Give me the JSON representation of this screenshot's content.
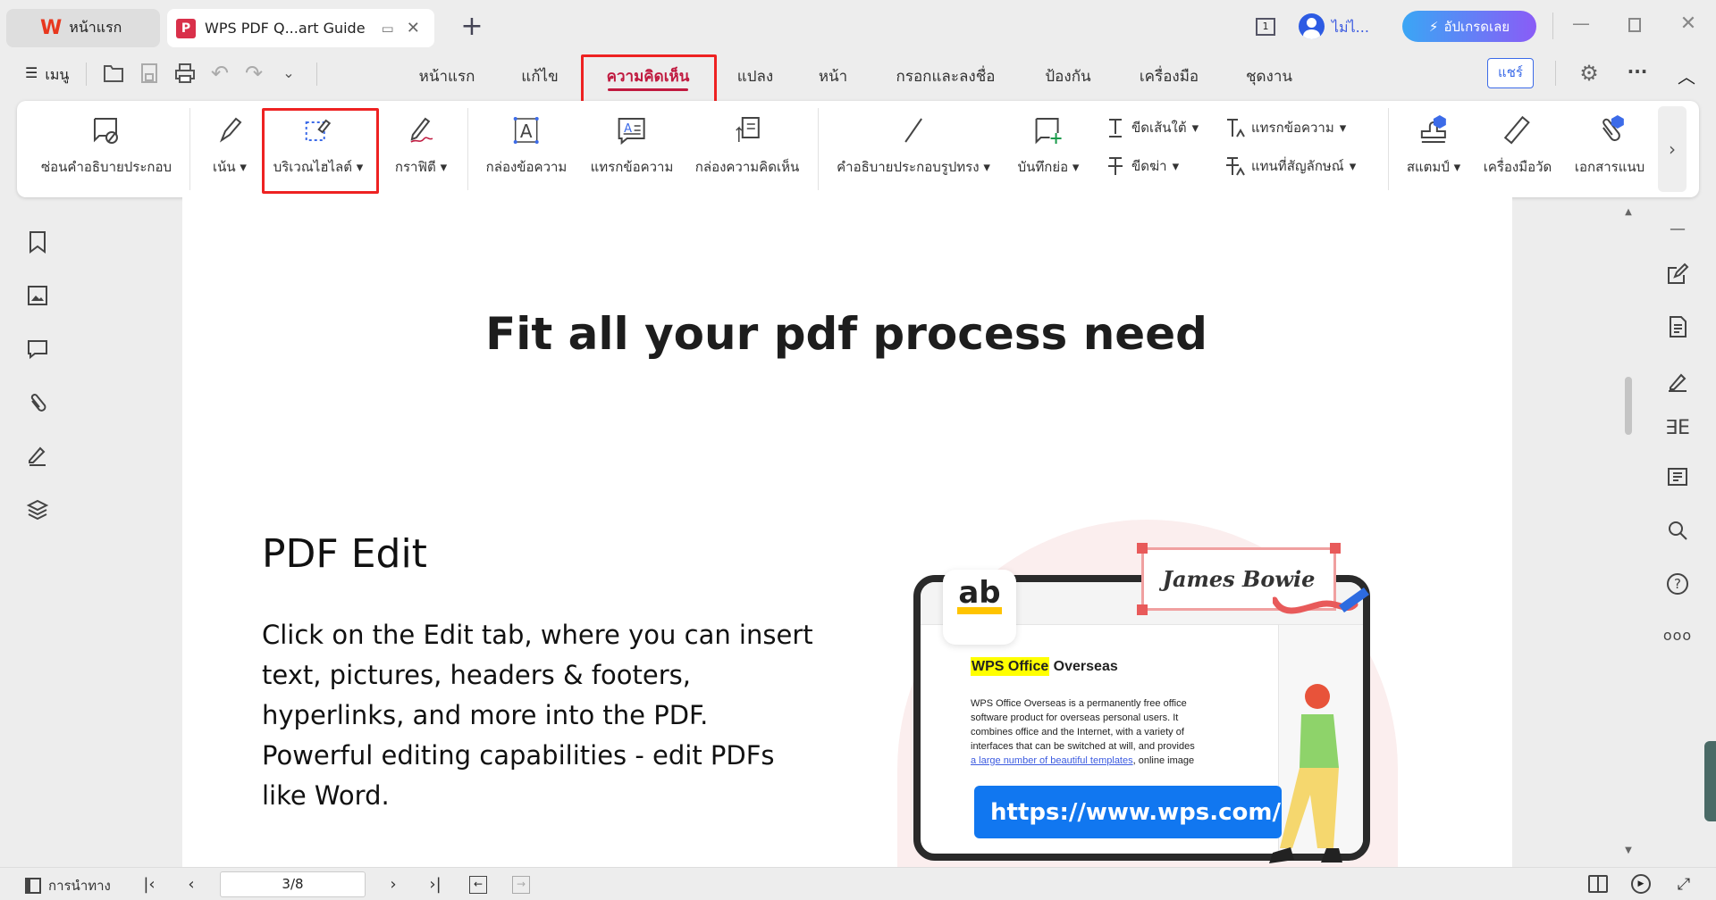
{
  "titlebar": {
    "home_tab": "หน้าแรก",
    "doc_tab": "WPS PDF Q...art Guide",
    "new_tab": "+",
    "page_count_badge": "1",
    "user_name": "ไม่ไ...",
    "upgrade_label": "อัปเกรดเลย"
  },
  "menubar": {
    "menu_label": "เมนู",
    "tabs": [
      "หน้าแรก",
      "แก้ไข",
      "ความคิดเห็น",
      "แปลง",
      "หน้า",
      "กรอกและลงชื่อ",
      "ป้องกัน",
      "เครื่องมือ",
      "ชุดงาน"
    ],
    "active_tab": "ความคิดเห็น",
    "share_label": "แชร์"
  },
  "ribbon": {
    "hide_annotations": "ซ่อนคำอธิบายประกอบ",
    "highlight": "เน้น",
    "area_highlight": "บริเวณไฮไลต์",
    "graffiti": "กราฟิตี",
    "text_box": "กล่องข้อความ",
    "insert_text": "แทรกข้อความ",
    "comment_box": "กล่องความคิดเห็น",
    "shape_annotation": "คำอธิบายประกอบรูปทรง",
    "sticky_note": "บันทึกย่อ",
    "underline": "ขีดเส้นใต้",
    "strikethrough": "ขีดฆ่า",
    "insert_text_small": "แทรกข้อความ",
    "replace_symbol": "แทนที่สัญลักษณ์",
    "stamp": "สแตมป์",
    "measure": "เครื่องมือวัด",
    "attachment": "เอกสารแนบ"
  },
  "document": {
    "title": "Fit all your pdf process need",
    "section_heading": "PDF Edit",
    "body_lines": [
      "Click on the Edit tab, where you can insert",
      "text, pictures, headers & footers,",
      "hyperlinks, and more into the PDF.",
      "Powerful editing capabilities - edit PDFs",
      "like Word."
    ],
    "illustration": {
      "ab_label": "ab",
      "signature": "James Bowie",
      "heading_highlight": "WPS Office",
      "heading_rest": " Overseas",
      "para_lines": [
        "WPS Office Overseas is a permanently free office",
        "software product for overseas personal users. It",
        "combines office and the Internet, with a variety of",
        "interfaces that can be switched at will, and provides"
      ],
      "link_text": "a large number of beautiful templates",
      "link_rest": ", online image",
      "url": "https://www.wps.com/"
    }
  },
  "statusbar": {
    "nav_label": "การนำทาง",
    "page_value": "3/8"
  },
  "colors": {
    "accent": "#c0193f",
    "highlight_box": "#ee2222",
    "upgrade_start": "#3aa6f5",
    "upgrade_end": "#8a5cf6",
    "url_blue": "#1177f0"
  }
}
